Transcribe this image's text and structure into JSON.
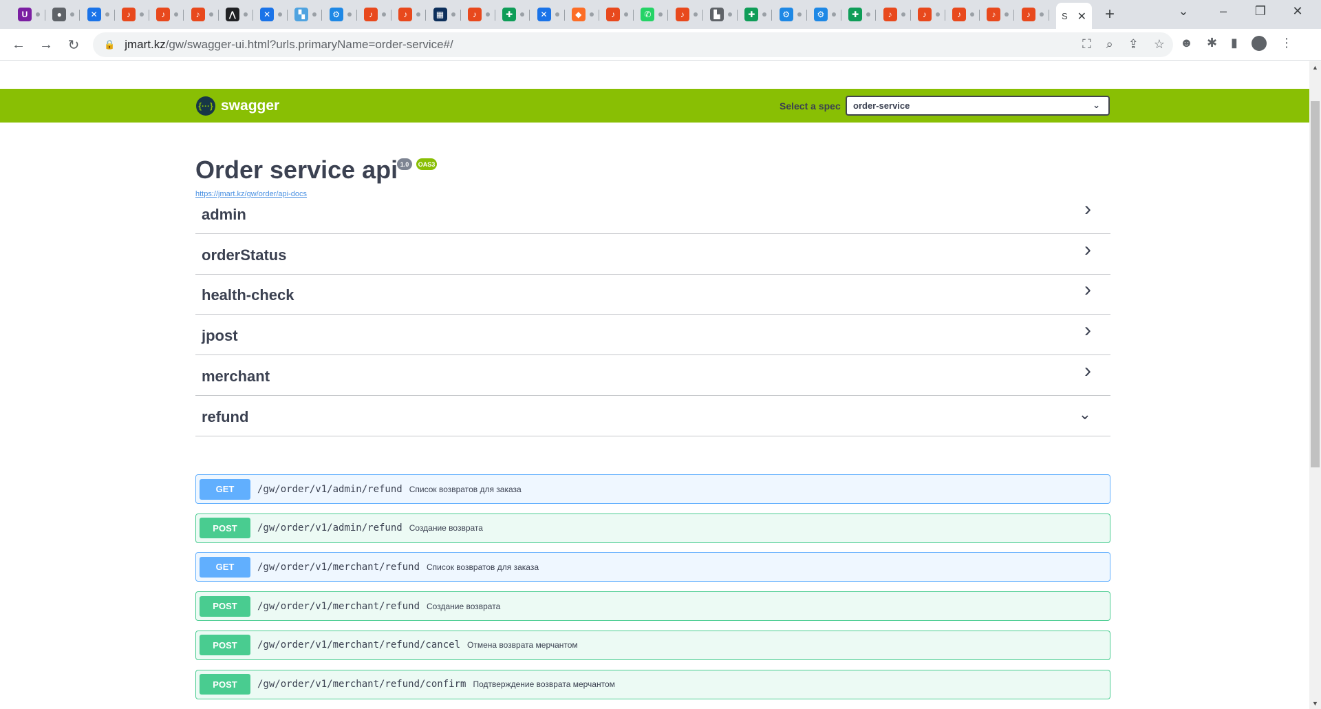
{
  "browser": {
    "tabs": [
      {
        "color": "#7b1fa2",
        "glyph": "U"
      },
      {
        "color": "#5f6368",
        "glyph": "●"
      },
      {
        "color": "#1a73e8",
        "glyph": "✕"
      },
      {
        "color": "#e8491d",
        "glyph": "♪"
      },
      {
        "color": "#e8491d",
        "glyph": "♪"
      },
      {
        "color": "#e8491d",
        "glyph": "♪"
      },
      {
        "color": "#202124",
        "glyph": "⋀"
      },
      {
        "color": "#1a73e8",
        "glyph": "✕"
      },
      {
        "color": "#4fa3e0",
        "glyph": "▚"
      },
      {
        "color": "#1e88e5",
        "glyph": "⚙"
      },
      {
        "color": "#e8491d",
        "glyph": "♪"
      },
      {
        "color": "#e8491d",
        "glyph": "♪"
      },
      {
        "color": "#0d2f5b",
        "glyph": "▦"
      },
      {
        "color": "#e8491d",
        "glyph": "♪"
      },
      {
        "color": "#0f9d58",
        "glyph": "✚"
      },
      {
        "color": "#1a73e8",
        "glyph": "✕"
      },
      {
        "color": "#fc6d26",
        "glyph": "◆"
      },
      {
        "color": "#e8491d",
        "glyph": "♪"
      },
      {
        "color": "#25d366",
        "glyph": "✆"
      },
      {
        "color": "#e8491d",
        "glyph": "♪"
      },
      {
        "color": "#5f6368",
        "glyph": "▙"
      },
      {
        "color": "#0f9d58",
        "glyph": "✚"
      },
      {
        "color": "#1e88e5",
        "glyph": "⚙"
      },
      {
        "color": "#1e88e5",
        "glyph": "⚙"
      },
      {
        "color": "#0f9d58",
        "glyph": "✚"
      },
      {
        "color": "#e8491d",
        "glyph": "♪"
      },
      {
        "color": "#e8491d",
        "glyph": "♪"
      },
      {
        "color": "#e8491d",
        "glyph": "♪"
      },
      {
        "color": "#e8491d",
        "glyph": "♪"
      },
      {
        "color": "#e8491d",
        "glyph": "♪"
      }
    ],
    "active_tab_label": "S",
    "url_host": "jmart.kz",
    "url_path": "/gw/swagger-ui.html?urls.primaryName=order-service#/"
  },
  "swagger": {
    "brand": "swagger",
    "logo_glyph": "{···}",
    "spec_label": "Select a spec",
    "spec_value": "order-service",
    "title": "Order service api",
    "version_badge": "1.0",
    "oas_badge": "OAS3",
    "docs_link": "https://jmart.kz/gw/order/api-docs",
    "tags": [
      {
        "name": "admin",
        "expanded": false
      },
      {
        "name": "orderStatus",
        "expanded": false
      },
      {
        "name": "health-check",
        "expanded": false
      },
      {
        "name": "jpost",
        "expanded": false
      },
      {
        "name": "merchant",
        "expanded": false
      },
      {
        "name": "refund",
        "expanded": true
      }
    ],
    "operations": [
      {
        "method": "GET",
        "path": "/gw/order/v1/admin/refund",
        "summary": "Список возвратов для заказа"
      },
      {
        "method": "POST",
        "path": "/gw/order/v1/admin/refund",
        "summary": "Создание возврата"
      },
      {
        "method": "GET",
        "path": "/gw/order/v1/merchant/refund",
        "summary": "Список возвратов для заказа"
      },
      {
        "method": "POST",
        "path": "/gw/order/v1/merchant/refund",
        "summary": "Создание возврата"
      },
      {
        "method": "POST",
        "path": "/gw/order/v1/merchant/refund/cancel",
        "summary": "Отмена возврата мерчантом"
      },
      {
        "method": "POST",
        "path": "/gw/order/v1/merchant/refund/confirm",
        "summary": "Подтверждение возврата мерчантом"
      }
    ]
  }
}
